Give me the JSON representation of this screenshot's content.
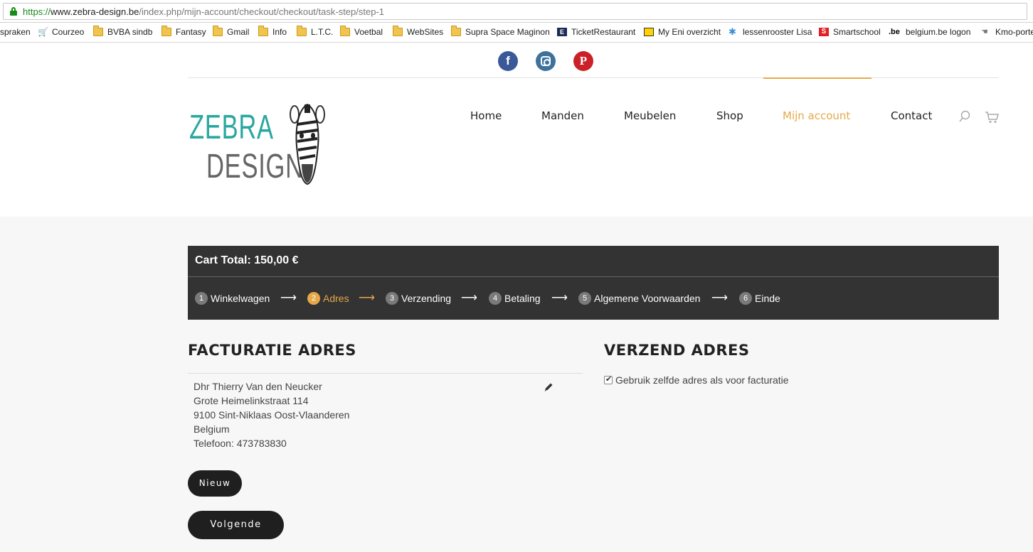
{
  "browser": {
    "url_scheme": "https://",
    "url_host": "www.zebra-design.be",
    "url_path": "/index.php/mijn-account/checkout/checkout/task-step/step-1",
    "bookmarks": [
      {
        "label": "spraken",
        "icon": "none"
      },
      {
        "label": "Courzeo",
        "icon": "cart-icon"
      },
      {
        "label": "BVBA sindb",
        "icon": "folder-icon"
      },
      {
        "label": "Fantasy",
        "icon": "folder-icon"
      },
      {
        "label": "Gmail",
        "icon": "folder-icon"
      },
      {
        "label": "Info",
        "icon": "folder-icon"
      },
      {
        "label": "L.T.C.",
        "icon": "folder-icon"
      },
      {
        "label": "Voetbal",
        "icon": "folder-icon"
      },
      {
        "label": "WebSites",
        "icon": "folder-icon"
      },
      {
        "label": "Supra Space Maginon",
        "icon": "folder-icon"
      },
      {
        "label": "TicketRestaurant",
        "icon": "ticketrestaurant-icon"
      },
      {
        "label": "My Eni overzicht",
        "icon": "eni-icon"
      },
      {
        "label": "lessenrooster Lisa",
        "icon": "lessenrooster-icon"
      },
      {
        "label": "Smartschool",
        "icon": "smartschool-icon"
      },
      {
        "label": "belgium.be logon",
        "icon": "belgium-icon"
      },
      {
        "label": "Kmo-porte",
        "icon": "kmo-icon"
      }
    ]
  },
  "header": {
    "social": [
      "facebook-icon",
      "instagram-icon",
      "pinterest-icon"
    ],
    "logo_line1": "ZEBRA",
    "logo_line2": "DESIGN",
    "nav": [
      "Home",
      "Manden",
      "Meubelen",
      "Shop",
      "Mijn account",
      "Contact"
    ],
    "active_nav": "Mijn account",
    "accent_color": "#e5a948"
  },
  "checkout": {
    "cart_total": "Cart Total: 150,00 €",
    "steps": [
      {
        "num": "1",
        "label": "Winkelwagen"
      },
      {
        "num": "2",
        "label": "Adres"
      },
      {
        "num": "3",
        "label": "Verzending"
      },
      {
        "num": "4",
        "label": "Betaling"
      },
      {
        "num": "5",
        "label": "Algemene Voorwaarden"
      },
      {
        "num": "6",
        "label": "Einde"
      }
    ],
    "current_step": "2",
    "arrow": "⟶"
  },
  "billing": {
    "title": "FACTURATIE ADRES",
    "lines": [
      "Dhr Thierry Van den Neucker",
      "Grote Heimelinkstraat 114",
      "9100 Sint-Niklaas Oost-Vlaanderen",
      "Belgium",
      "Telefoon: 473783830"
    ]
  },
  "shipping": {
    "title": "VERZEND ADRES",
    "same_address_label": "Gebruik zelfde adres als voor facturatie",
    "same_address_checked": true
  },
  "buttons": {
    "new": "Nieuw",
    "next": "Volgende"
  }
}
